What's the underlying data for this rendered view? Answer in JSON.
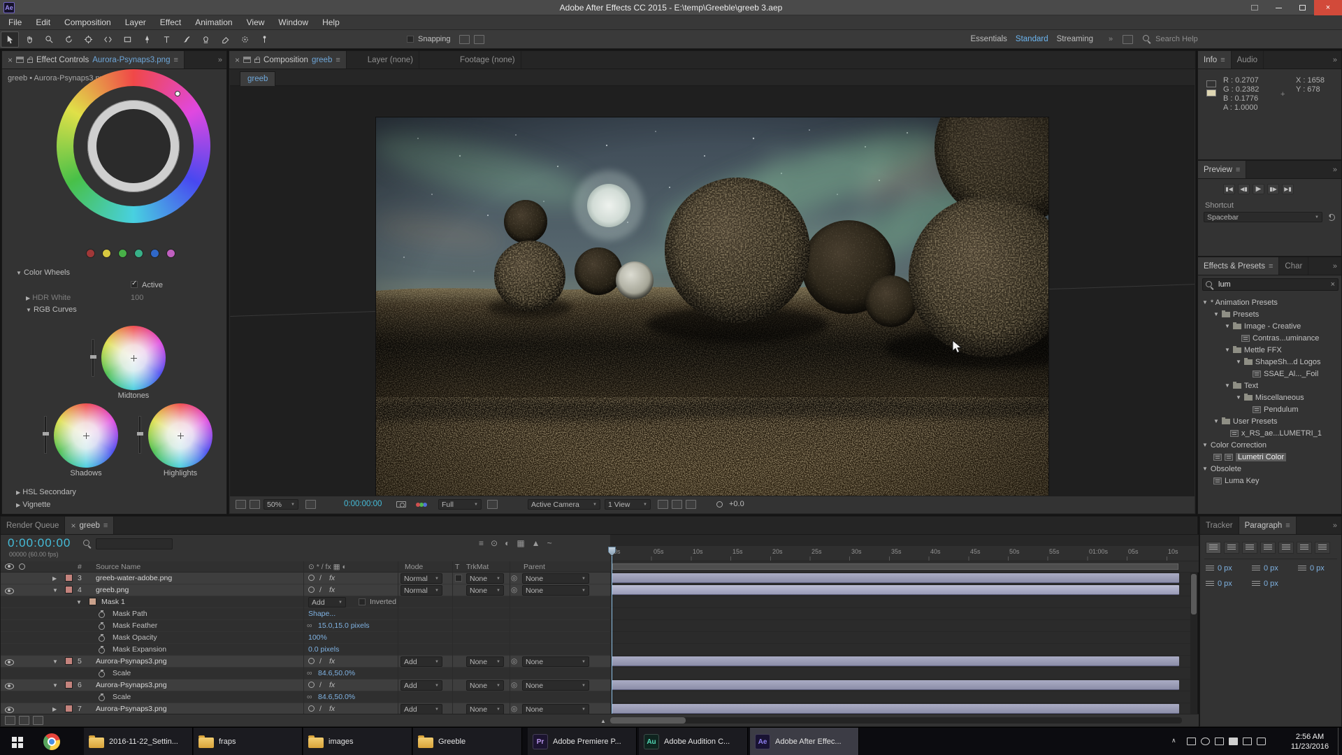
{
  "titlebar": {
    "title": "Adobe After Effects CC 2015 - E:\\temp\\Greeble\\greeb 3.aep"
  },
  "menubar": {
    "items": [
      "File",
      "Edit",
      "Composition",
      "Layer",
      "Effect",
      "Animation",
      "View",
      "Window",
      "Help"
    ]
  },
  "toolbar": {
    "snapping": "Snapping",
    "workspaces": [
      "Essentials",
      "Standard",
      "Streaming"
    ],
    "search_placeholder": "Search Help"
  },
  "effect_controls": {
    "tab_label": "Effect Controls",
    "tab_item": "Aurora-Psynaps3.png",
    "breadcrumb": "greeb • Aurora-Psynaps3.png",
    "color_wheels": "Color Wheels",
    "active": "Active",
    "hdr_white": "HDR White",
    "hdr_white_value": "100",
    "rgb_curves": "RGB Curves",
    "midtones": "Midtones",
    "shadows": "Shadows",
    "highlights": "Highlights",
    "hsl_secondary": "HSL Secondary",
    "vignette": "Vignette"
  },
  "comp": {
    "tab_label": "Composition",
    "tab_item": "greeb",
    "tab_layer": "Layer (none)",
    "tab_footage": "Footage (none)",
    "viewer_tab": "greeb",
    "zoom": "50%",
    "timecode": "0:00:00:00",
    "resolution": "Full",
    "camera": "Active Camera",
    "views": "1 View",
    "exposure": "+0.0"
  },
  "info": {
    "tab": "Info",
    "tab_audio": "Audio",
    "r": "R : 0.2707",
    "g": "G : 0.2382",
    "b": "B : 0.1776",
    "a": "A : 1.0000",
    "x": "X : 1658",
    "y": "Y : 678"
  },
  "preview": {
    "tab": "Preview",
    "shortcut_label": "Shortcut",
    "shortcut": "Spacebar"
  },
  "effects": {
    "tab": "Effects & Presets",
    "tab2": "Char",
    "search": "lum",
    "tree": [
      {
        "label": "* Animation Presets"
      },
      {
        "label": "Presets"
      },
      {
        "label": "Image - Creative"
      },
      {
        "label": "Contras...uminance"
      },
      {
        "label": "Mettle FFX"
      },
      {
        "label": "ShapeSh...d Logos"
      },
      {
        "label": "SSAE_Al..._Foil"
      },
      {
        "label": "Text"
      },
      {
        "label": "Miscellaneous"
      },
      {
        "label": "Pendulum"
      },
      {
        "label": "User Presets"
      },
      {
        "label": "x_RS_ae...LUMETRI_1"
      },
      {
        "label": "Color Correction"
      },
      {
        "label": "Lumetri Color"
      },
      {
        "label": "Obsolete"
      },
      {
        "label": "Luma Key"
      }
    ]
  },
  "timeline": {
    "tab_render_queue": "Render Queue",
    "tab_comp": "greeb",
    "timecode": "0:00:00:00",
    "frame_info": "00000 (60.00 fps)",
    "col_num": "#",
    "col_source": "Source Name",
    "col_mode": "Mode",
    "col_t": "T",
    "col_trkmat": "TrkMat",
    "col_parent": "Parent",
    "ruler": [
      "0s",
      "05s",
      "10s",
      "15s",
      "20s",
      "25s",
      "30s",
      "35s",
      "40s",
      "45s",
      "50s",
      "55s",
      "01:00s",
      "05s",
      "10s"
    ],
    "rows": [
      {
        "num": "3",
        "name": "greeb-water-adobe.png",
        "mode": "Normal",
        "trkmat": "None",
        "parent": "None"
      },
      {
        "num": "4",
        "name": "greeb.png",
        "mode": "Normal",
        "trkmat": "None",
        "parent": "None"
      },
      {
        "name": "Mask 1",
        "mode": "Add",
        "inverted": "Inverted"
      },
      {
        "name": "Mask Path",
        "value": "Shape..."
      },
      {
        "name": "Mask Feather",
        "value": "15.0,15.0 pixels"
      },
      {
        "name": "Mask Opacity",
        "value": "100%"
      },
      {
        "name": "Mask Expansion",
        "value": "0.0 pixels"
      },
      {
        "num": "5",
        "name": "Aurora-Psynaps3.png",
        "mode": "Add",
        "trkmat": "None",
        "parent": "None"
      },
      {
        "name": "Scale",
        "value": "84.6,50.0%"
      },
      {
        "num": "6",
        "name": "Aurora-Psynaps3.png",
        "mode": "Add",
        "trkmat": "None",
        "parent": "None"
      },
      {
        "name": "Scale",
        "value": "84.6,50.0%"
      },
      {
        "num": "7",
        "name": "Aurora-Psynaps3.png",
        "mode": "Add",
        "trkmat": "None",
        "parent": "None"
      }
    ]
  },
  "tracker": {
    "tab": "Tracker"
  },
  "paragraph": {
    "tab": "Paragraph",
    "indent_values": [
      "0 px",
      "0 px",
      "0 px"
    ],
    "spacing_values": [
      "0 px",
      "0 px"
    ]
  },
  "taskbar": {
    "apps": [
      {
        "label": "2016-11-22_Settin..."
      },
      {
        "label": "fraps"
      },
      {
        "label": "images"
      },
      {
        "label": "Greeble"
      },
      {
        "label": "Adobe Premiere P..."
      },
      {
        "label": "Adobe Audition C..."
      },
      {
        "label": "Adobe After Effec..."
      }
    ],
    "time": "2:56 AM",
    "date": "11/23/2016"
  }
}
